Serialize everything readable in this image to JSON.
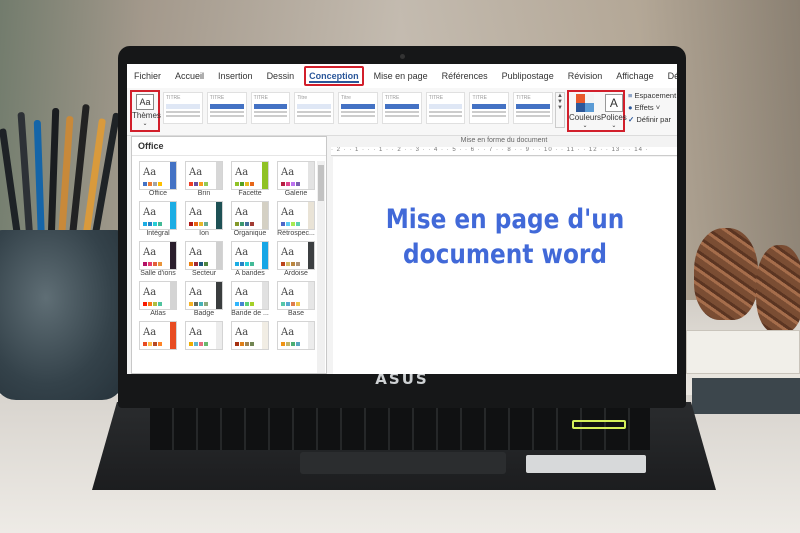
{
  "brand": {
    "logo_text": "ASUS"
  },
  "ribbon_tabs": [
    {
      "label": "Fichier"
    },
    {
      "label": "Accueil"
    },
    {
      "label": "Insertion"
    },
    {
      "label": "Dessin"
    },
    {
      "label": "Conception",
      "active": true
    },
    {
      "label": "Mise en page"
    },
    {
      "label": "Références"
    },
    {
      "label": "Publipostage"
    },
    {
      "label": "Révision"
    },
    {
      "label": "Affichage"
    },
    {
      "label": "Développeur"
    }
  ],
  "ribbon": {
    "themes_label": "Thèmes",
    "themes_tile": "Aa",
    "couleurs_label": "Couleurs",
    "polices_label": "Polices",
    "polices_tile": "A",
    "espacement_label": "Espacement",
    "effets_label": "Effets ˅",
    "definir_label": "Définir par",
    "gallery_titles": [
      "TITRE",
      "TITRE",
      "TITRE",
      "Titre",
      "Titre",
      "TITRE",
      "TITRE",
      "TITRE",
      "TITRE"
    ]
  },
  "theme_panel": {
    "heading": "Office",
    "themes": [
      {
        "name": "Office",
        "colors": [
          "#4472c4",
          "#ed7d31",
          "#a5a5a5",
          "#ffc000"
        ],
        "side": "#4472c4"
      },
      {
        "name": "Brin",
        "colors": [
          "#ef3b24",
          "#6a4c9c",
          "#f99b1c",
          "#94c954"
        ],
        "side": "#d7d7d7"
      },
      {
        "name": "Facette",
        "colors": [
          "#90c226",
          "#54a021",
          "#e6b91e",
          "#e76618"
        ],
        "side": "#90c226"
      },
      {
        "name": "Galerie",
        "colors": [
          "#b71e42",
          "#de478e",
          "#bc72f0",
          "#795faf"
        ],
        "side": "#e3e3e3"
      },
      {
        "name": "Intégral",
        "colors": [
          "#1cade4",
          "#2683c6",
          "#27ced7",
          "#42ba97"
        ],
        "side": "#1cade4"
      },
      {
        "name": "Ion",
        "colors": [
          "#b01513",
          "#ea6312",
          "#e6b729",
          "#6aac90"
        ],
        "side": "#1e5155"
      },
      {
        "name": "Organique",
        "colors": [
          "#83992a",
          "#3c9770",
          "#44709d",
          "#a23c33"
        ],
        "side": "#d4d0c4"
      },
      {
        "name": "Rétrospec...",
        "colors": [
          "#4e67c8",
          "#5eccf3",
          "#a7ea52",
          "#5dceaf"
        ],
        "side": "#e9e3d6"
      },
      {
        "name": "Salle d'ions",
        "colors": [
          "#b31166",
          "#e33d6f",
          "#e45f3c",
          "#e9943a"
        ],
        "side": "#2a1e2c"
      },
      {
        "name": "Secteur",
        "colors": [
          "#f07f09",
          "#9f2936",
          "#1b587c",
          "#4e8542"
        ],
        "side": "#d0d0d0"
      },
      {
        "name": "À bandes",
        "colors": [
          "#1cade4",
          "#2683c6",
          "#27ced7",
          "#42ba97"
        ],
        "side": "#17a6e6"
      },
      {
        "name": "Ardoise",
        "colors": [
          "#bc451b",
          "#d3ba68",
          "#bb8640",
          "#ad9277"
        ],
        "side": "#3c3f41"
      },
      {
        "name": "Atlas",
        "colors": [
          "#f81b02",
          "#fc7715",
          "#afbf41",
          "#50c49f"
        ],
        "side": "#d4d4d4"
      },
      {
        "name": "Badge",
        "colors": [
          "#f8b323",
          "#656a59",
          "#46b2b5",
          "#8caa7e"
        ],
        "side": "#3a3d3e"
      },
      {
        "name": "Bande de ...",
        "colors": [
          "#31b6fd",
          "#4584d3",
          "#5bd078",
          "#a5d028"
        ],
        "side": "#e1e1e1"
      },
      {
        "name": "Base",
        "colors": [
          "#56c7aa",
          "#59a8d1",
          "#df7d4c",
          "#f0c54e"
        ],
        "side": "#e6e6e6"
      },
      {
        "name": "",
        "colors": [
          "#e84c22",
          "#ffbd47",
          "#b64926",
          "#ff8427"
        ],
        "side": "#e84c22"
      },
      {
        "name": "",
        "colors": [
          "#f0ad00",
          "#60b5cc",
          "#e66c7d",
          "#6bb76d"
        ],
        "side": "#ececec"
      },
      {
        "name": "",
        "colors": [
          "#a53010",
          "#de7e18",
          "#9f8351",
          "#728653"
        ],
        "side": "#f1ede4"
      },
      {
        "name": "",
        "colors": [
          "#f09415",
          "#c1b56b",
          "#4baf73",
          "#5aa6c0"
        ],
        "side": "#ececec"
      }
    ]
  },
  "document": {
    "ruler_label": "Mise en forme du document",
    "ruler_ticks": "· 2 · · 1 · · · 1 · · 2 · · 3 · · 4 · · 5 · · 6 · · 7 · · 8 · · 9 · · 10 · · 11 · · 12 · · 13 · · 14 ·",
    "title_line1": "Mise en page d'un",
    "title_line2": "document word"
  }
}
